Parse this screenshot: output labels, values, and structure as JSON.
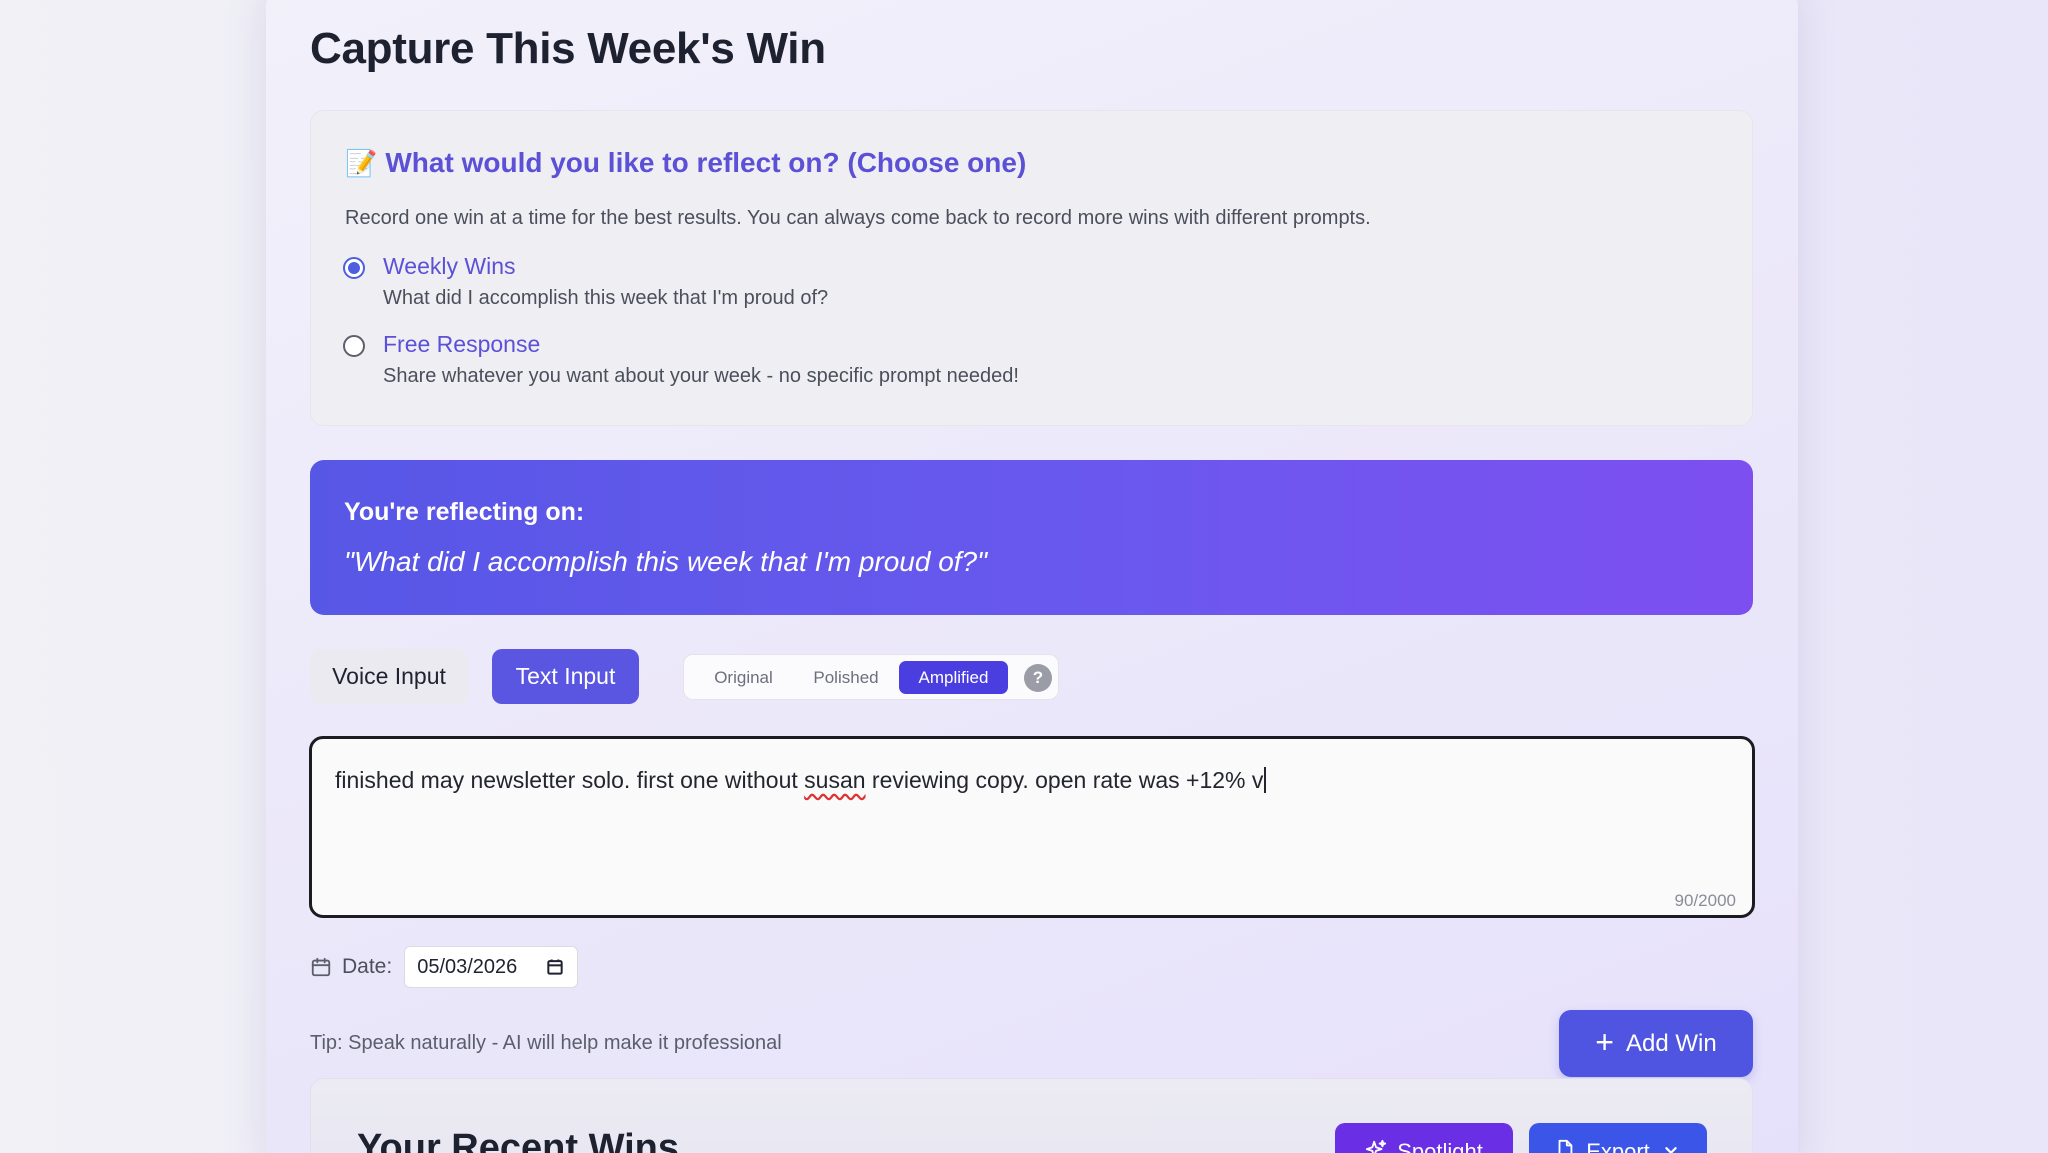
{
  "page": {
    "title": "Capture This Week's Win"
  },
  "prompt_panel": {
    "icon": "memo-icon",
    "emoji": "📝",
    "heading": "What would you like to reflect on? (Choose one)",
    "description": "Record one win at a time for the best results. You can always come back to record more wins with different prompts.",
    "options": [
      {
        "label": "Weekly Wins",
        "sub": "What did I accomplish this week that I'm proud of?",
        "selected": true
      },
      {
        "label": "Free Response",
        "sub": "Share whatever you want about your week - no specific prompt needed!",
        "selected": false
      }
    ]
  },
  "reflect_banner": {
    "label": "You're reflecting on:",
    "quote": "\"What did I accomplish this week that I'm proud of?\""
  },
  "input_modes": {
    "voice_label": "Voice Input",
    "text_label": "Text Input",
    "active": "Text Input"
  },
  "version_toggle": {
    "original": "Original",
    "polished": "Polished",
    "amplified": "Amplified",
    "active": "Amplified",
    "help": "?"
  },
  "text_area": {
    "value_before": "finished may newsletter solo. first one without ",
    "value_misspelled": "susan",
    "value_after": " reviewing copy. open rate was +12% v",
    "char_count": "90/2000"
  },
  "date": {
    "label": "Date:",
    "value": "05/03/2026"
  },
  "tip": "Tip: Speak naturally - AI will help make it professional",
  "add_win": {
    "plus": "+",
    "label": "Add Win"
  },
  "recent": {
    "title": "Your Recent Wins",
    "spotlight_label": "Spotlight",
    "export_label": "Export"
  },
  "colors": {
    "accent": "#5a56e2",
    "heading_purple": "#5b50d6",
    "banner_start": "#5757e6",
    "banner_end": "#7d4ff0"
  }
}
